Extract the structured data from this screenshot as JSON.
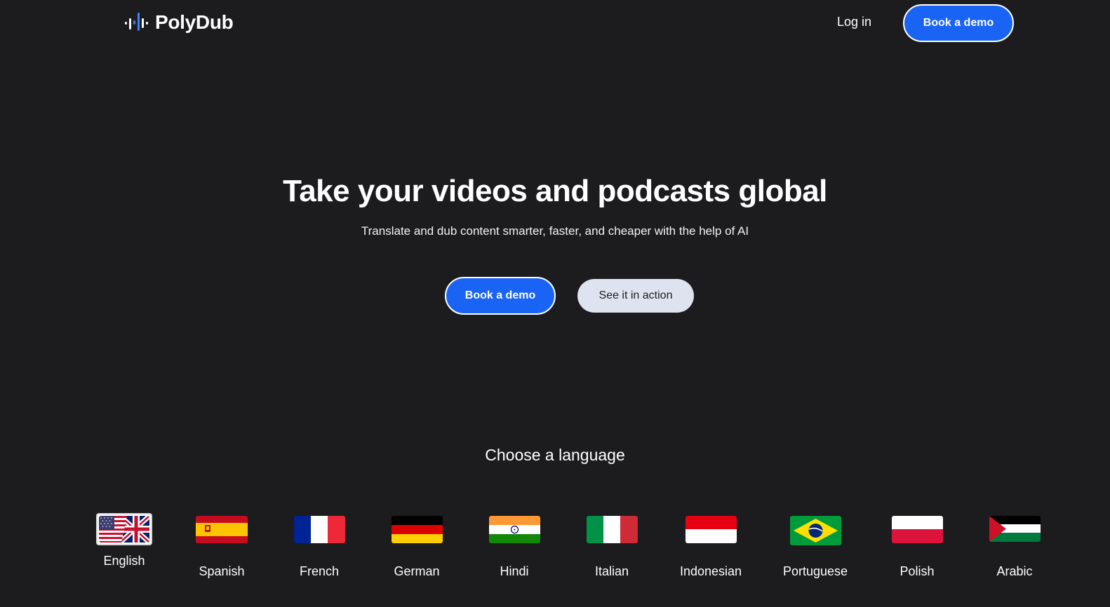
{
  "header": {
    "brand": "PolyDub",
    "login_label": "Log in",
    "demo_label": "Book a demo"
  },
  "hero": {
    "title": "Take your videos and podcasts global",
    "subtitle": "Translate and dub content smarter, faster, and cheaper with the help of AI",
    "demo_label": "Book a demo",
    "action_label": "See it in action"
  },
  "languages": {
    "heading": "Choose a language",
    "selected": "English",
    "items": [
      {
        "label": "English",
        "flag": "us-uk-flag-icon"
      },
      {
        "label": "Spanish",
        "flag": "spain-flag-icon"
      },
      {
        "label": "French",
        "flag": "france-flag-icon"
      },
      {
        "label": "German",
        "flag": "germany-flag-icon"
      },
      {
        "label": "Hindi",
        "flag": "india-flag-icon"
      },
      {
        "label": "Italian",
        "flag": "italy-flag-icon"
      },
      {
        "label": "Indonesian",
        "flag": "indonesia-flag-icon"
      },
      {
        "label": "Portuguese",
        "flag": "brazil-flag-icon"
      },
      {
        "label": "Polish",
        "flag": "poland-flag-icon"
      },
      {
        "label": "Arabic",
        "flag": "palestine-flag-icon"
      }
    ]
  },
  "colors": {
    "background": "#1c1c1e",
    "accent": "#1a64f5",
    "secondary_button": "#dfe3ef"
  }
}
